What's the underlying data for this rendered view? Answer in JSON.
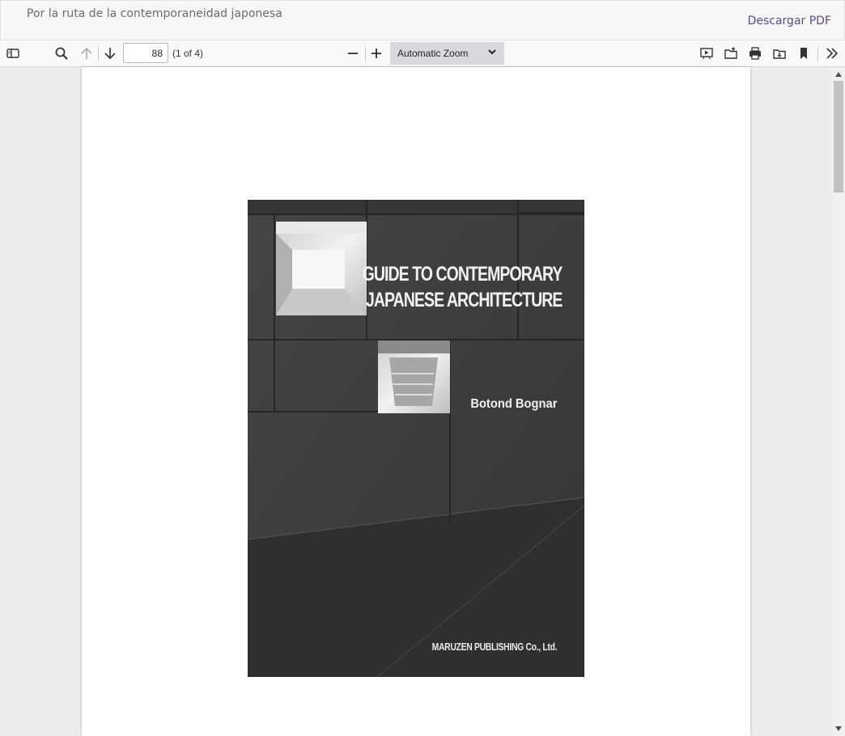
{
  "header": {
    "title": "Por la ruta de la contemporaneidad japonesa",
    "download_label": "Descargar PDF"
  },
  "toolbar": {
    "page_number": "88",
    "page_count": "(1 of 4)",
    "zoom_value": "Automatic Zoom",
    "icons": [
      "sidebar-toggle-icon",
      "search-icon",
      "arrow-up-icon",
      "arrow-down-icon",
      "minus-icon",
      "plus-icon",
      "chevron-down-icon",
      "presentation-icon",
      "open-file-icon",
      "print-icon",
      "download-icon",
      "bookmark-icon",
      "double-chevron-right-icon"
    ]
  },
  "document": {
    "cover_title_line1": "GUIDE TO CONTEMPORARY",
    "cover_title_line2": "JAPANESE ARCHITECTURE",
    "cover_author": "Botond Bognar",
    "cover_publisher": "MARUZEN PUBLISHING Co., Ltd."
  },
  "colors": {
    "accent_link": "#5a4a86",
    "toolbar_bg": "#f9f9fa",
    "viewer_bg": "#ededf0",
    "cover_bg": "#3d3d3d"
  }
}
